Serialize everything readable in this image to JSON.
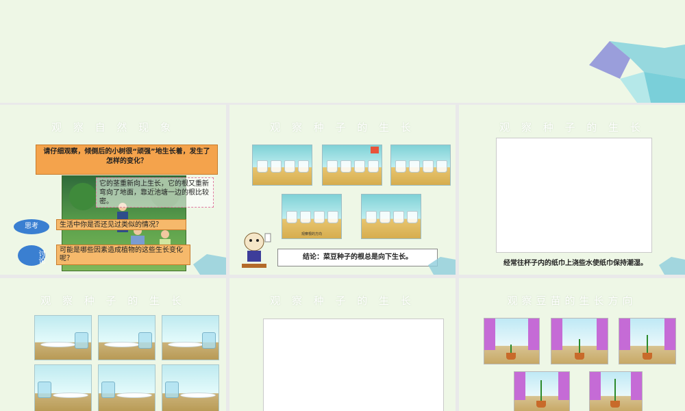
{
  "slides": {
    "s1": {
      "title": "观 察 自 然 现 象",
      "prompt": "请仔细观察，倾倒后的小树很“顽强”地生长着，发生了怎样的变化？",
      "note": "它的茎重新向上生长，它的根又重新弯向了地面，靠近池塘一边的根比较密。",
      "think_label": "思考",
      "think_question": "生活中你是否还见过类似的情况？",
      "discuss_label": "讨论",
      "discuss_question": "可能是哪些因素造成植物的这些生长变化呢？"
    },
    "s2": {
      "title": "观 察 种 子 的 生 长",
      "thumb_caption": "观察根的方向",
      "conclusion": "结论：菜豆种子的根总是向下生长。"
    },
    "s3": {
      "title": "观 察 种 子 的 生 长",
      "caption": "经常往杯子内的纸巾上浇些水使纸巾保持潮湿。"
    },
    "s4": {
      "title": "观 察 种 子 的 生 长"
    },
    "s5": {
      "title": "观 察 种 子 的 生 长"
    },
    "s6": {
      "title": "观察豆苗的生长方向"
    }
  },
  "colors": {
    "slide_bg": "#eef7e6",
    "title": "#ffffff",
    "accent_orange": "#f4a34c",
    "accent_blue": "#3a7fd1"
  }
}
